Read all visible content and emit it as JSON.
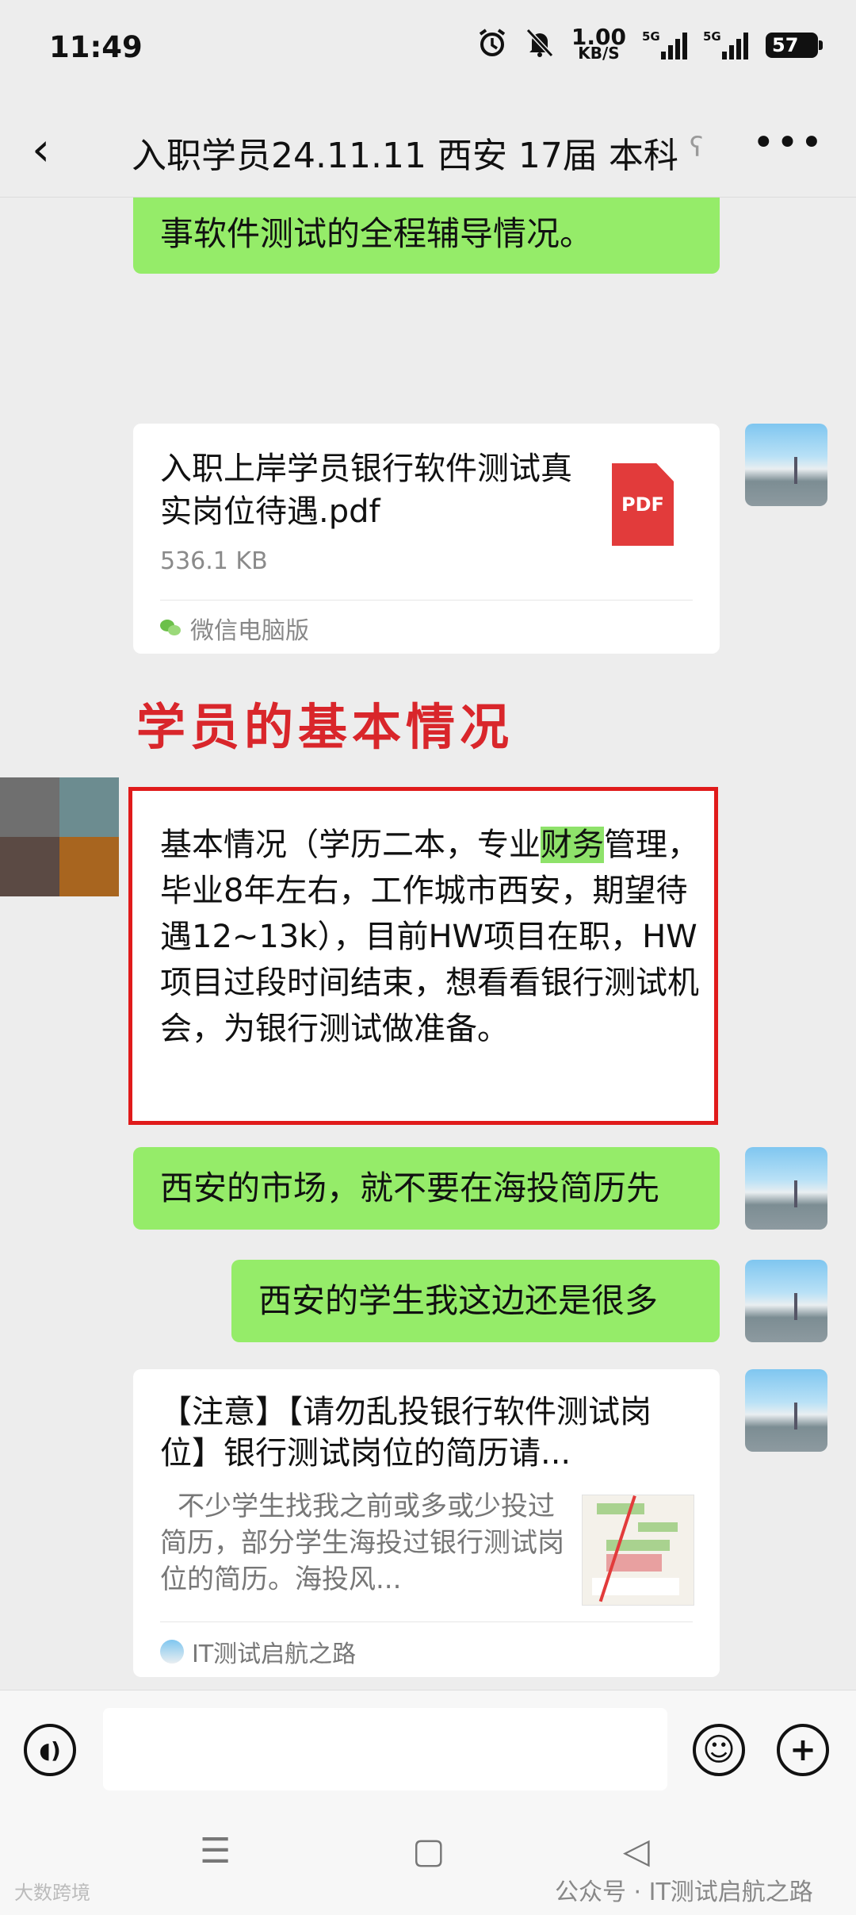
{
  "status_bar": {
    "time": "11:49",
    "net_speed": "1.00",
    "net_unit": "KB/S",
    "sig1_label": "5G",
    "sig2_label": "5G",
    "battery": "57"
  },
  "header": {
    "back_icon": "‹",
    "title": "入职学员24.11.11 西安 17届 本科",
    "ear_icon": "ʕ",
    "more_icon": "•••"
  },
  "messages": {
    "partial_text": "事软件测试的全程辅导情况。",
    "file": {
      "title": "入职上岸学员银行软件测试真实岗位待遇.pdf",
      "size": "536.1 KB",
      "source": "微信电脑版",
      "pdf_label": "PDF"
    },
    "heading": "学员的基本情况",
    "basic_before": "基本情况（学历二本，专业",
    "basic_highlight": "财务",
    "basic_after": "管理，毕业8年左右，工作城市西安，期望待遇12~13k），目前HW项目在职，HW项目过段时间结束，想看看银行测试机会，为银行测试做准备。",
    "msg1": "西安的市场，就不要在海投简历先",
    "msg2": "西安的学生我这边还是很多",
    "article": {
      "title": "【注意】【请勿乱投银行软件测试岗位】银行测试岗位的简历请...",
      "desc": "不少学生找我之前或多或少投过简历，部分学生海投过银行测试岗位的简历。海投风...",
      "source": "IT测试启航之路"
    }
  },
  "input_bar": {
    "voice_icon": "◖)",
    "emoji_icon": "☺",
    "plus_icon": "+"
  },
  "nav": {
    "menu_icon": "☰",
    "home_icon": "▢",
    "back_icon": "◁"
  },
  "watermark": {
    "left": "大数跨境",
    "right": "公众号 · IT测试启航之路"
  }
}
